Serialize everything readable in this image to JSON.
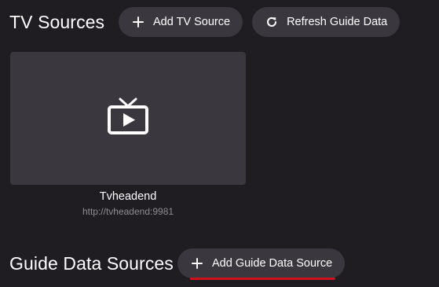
{
  "tv_sources": {
    "title": "TV Sources",
    "add_button_label": "Add TV Source",
    "add_button_icon": "plus-icon",
    "refresh_button_label": "Refresh Guide Data",
    "refresh_button_icon": "refresh-icon",
    "sources": [
      {
        "name": "Tvheadend",
        "url": "http://tvheadend:9981",
        "icon": "tv-play-icon"
      }
    ]
  },
  "guide_sources": {
    "title": "Guide Data Sources",
    "add_button_label": "Add Guide Data Source",
    "add_button_icon": "plus-icon"
  },
  "colors": {
    "background": "#1f1d22",
    "surface": "#3a373e",
    "text": "#ffffff",
    "muted_text": "#8f8b93",
    "highlight_underline": "#d0101c"
  }
}
